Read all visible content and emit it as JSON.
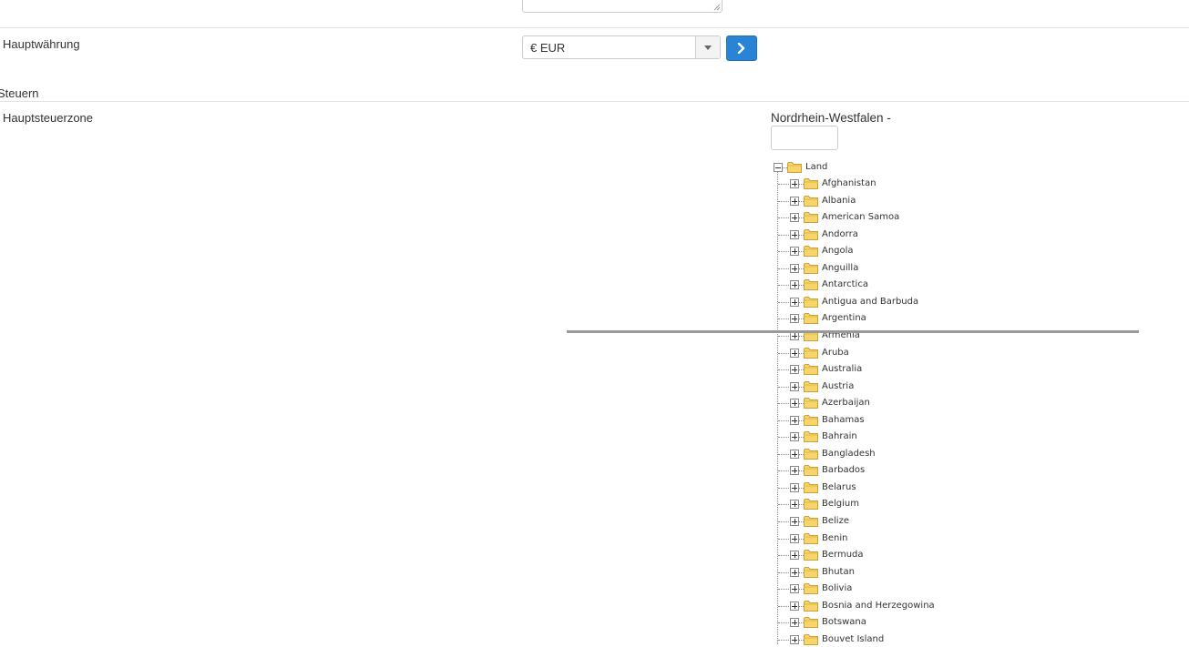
{
  "fields": {
    "main_currency": {
      "label": "Hauptwährung",
      "selected": "€ EUR"
    },
    "taxes_section": {
      "heading": "Steuern"
    },
    "main_tax_zone": {
      "label": "Hauptsteuerzone",
      "current_value": "Nordrhein-Westfalen -",
      "search_value": ""
    }
  },
  "tree": {
    "root": "Land",
    "countries": [
      "Afghanistan",
      "Albania",
      "American Samoa",
      "Andorra",
      "Angola",
      "Anguilla",
      "Antarctica",
      "Antigua and Barbuda",
      "Argentina",
      "Armenia",
      "Aruba",
      "Australia",
      "Austria",
      "Azerbaijan",
      "Bahamas",
      "Bahrain",
      "Bangladesh",
      "Barbados",
      "Belarus",
      "Belgium",
      "Belize",
      "Benin",
      "Bermuda",
      "Bhutan",
      "Bolivia",
      "Bosnia and Herzegowina",
      "Botswana",
      "Bouvet Island"
    ]
  },
  "colors": {
    "accent": "#2a84d6",
    "folder": "#f7d56a",
    "folder_outline": "#c9a23a"
  },
  "icons": {
    "go_button": "chevron-right-icon",
    "dropdown": "caret-down-icon",
    "tree_toggle": "plus-minus-box-icon",
    "tree_node": "folder-icon"
  }
}
